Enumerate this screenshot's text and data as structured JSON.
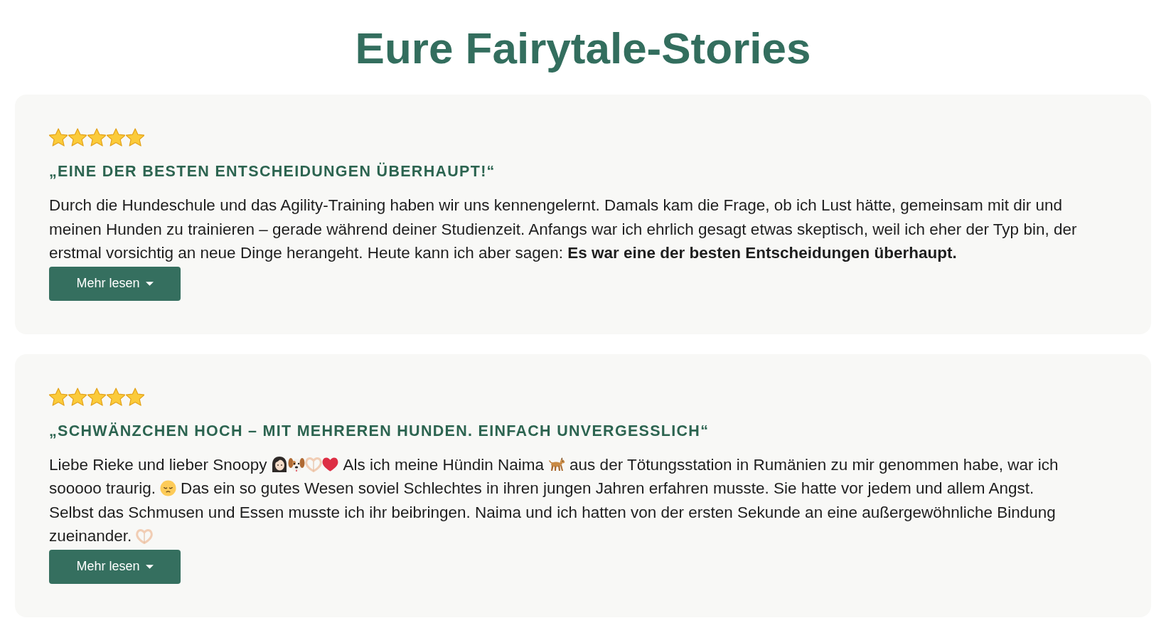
{
  "title": "Eure Fairytale-Stories",
  "cards": [
    {
      "stars": 5,
      "heading": "„EINE DER BESTEN ENTSCHEIDUNGEN ÜBERHAUPT!“",
      "body": [
        [
          {
            "kind": "text",
            "text": "Durch die Hundeschule und das Agility-Training haben wir uns kennengelernt. Damals kam die Frage, ob ich Lust hätte, gemeinsam mit dir und meinen Hunden zu trainieren – gerade während deiner Studienzeit. Anfangs war ich ehrlich gesagt etwas skeptisch, weil ich eher der Typ bin, der erstmal vorsichtig an neue Dinge herangeht. Heute kann ich aber sagen: **Es war eine der besten Entscheidungen überhaupt.**"
          }
        ]
      ],
      "button": "Mehr lesen"
    },
    {
      "stars": 5,
      "heading": "„SCHWÄNZCHEN HOCH – MIT MEHREREN HUNDEN. EINFACH UNVERGESSLICH“",
      "body": [
        [
          {
            "kind": "text",
            "text": "Liebe Rieke und lieber Snoopy"
          },
          {
            "kind": "woman"
          },
          {
            "kind": "puppy"
          },
          {
            "kind": "hearthands"
          },
          {
            "kind": "heart"
          },
          {
            "kind": "text",
            "text": "Als ich meine Hündin Naima"
          },
          {
            "kind": "dog"
          },
          {
            "kind": "text",
            "text": "aus der Tötungsstation in Rumänien zu mir genommen habe, war ich"
          }
        ],
        [
          {
            "kind": "text",
            "text": "sooooo traurig."
          },
          {
            "kind": "pensive"
          },
          {
            "kind": "text",
            "text": "Das ein so gutes Wesen soviel Schlechtes in ihren jungen Jahren erfahren musste. Sie hatte vor jedem und allem Angst."
          }
        ],
        [
          {
            "kind": "text",
            "text": "Selbst das Schmusen und Essen musste ich ihr beibringen. Naima und ich hatten von der ersten Sekunde an eine außergewöhnliche Bindung"
          }
        ],
        [
          {
            "kind": "text",
            "text": "zueinander."
          },
          {
            "kind": "hearthands"
          }
        ]
      ],
      "button": "Mehr lesen"
    }
  ]
}
